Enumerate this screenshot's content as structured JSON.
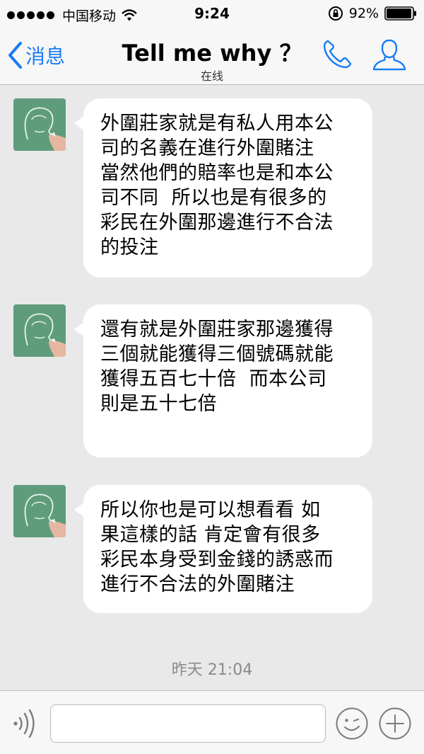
{
  "status_bar": {
    "carrier": "中国移动",
    "time": "9:24",
    "battery": "92%"
  },
  "nav": {
    "back_label": "消息",
    "title": "Tell me why ？",
    "subtitle": "在线",
    "accent_color": "#1a7cf5"
  },
  "messages": [
    {
      "lines": [
        "外圍莊家就是有私人用本公",
        "司的名義在進行外圍賭注",
        "當然他們的賠率也是和本公",
        "司不同  所以也是有很多的",
        "彩民在外圍那邊進行不合法",
        "的投注"
      ]
    },
    {
      "lines": [
        "還有就是外圍莊家那邊獲得",
        "三個就能獲得三個號碼就能",
        "獲得五百七十倍  而本公司",
        "則是五十七倍"
      ]
    },
    {
      "lines": [
        "所以你也是可以想看看 如",
        "果這樣的話 肯定會有很多",
        "彩民本身受到金錢的誘惑而",
        "進行不合法的外圍賭注"
      ]
    }
  ],
  "timestamp": "昨天 21:04",
  "input": {
    "value": "",
    "placeholder": ""
  },
  "icons": {
    "wifi": "wifi-icon",
    "rotation_lock": "rotation-lock-icon",
    "battery": "battery-icon",
    "back": "chevron-left-icon",
    "phone": "phone-icon",
    "contact": "person-icon",
    "voice": "voice-icon",
    "emoji": "emoji-icon",
    "plus": "plus-icon",
    "avatar": "avatar-icon"
  }
}
